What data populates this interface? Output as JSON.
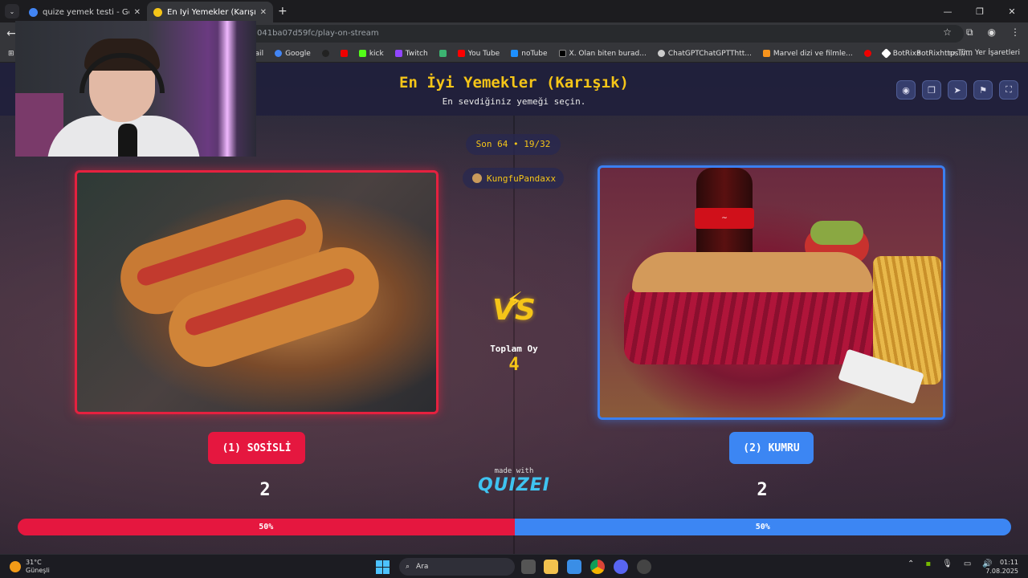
{
  "browser": {
    "tabs": [
      {
        "title": "quize yemek testi - Google'da A",
        "active": false
      },
      {
        "title": "En İyi Yemekler (Karışık) - Quize",
        "active": true
      }
    ],
    "new_tab_glyph": "+",
    "address": "041ba07d59fc/play-on-stream",
    "bookmarks": [
      "ail",
      "Google",
      "kick",
      "Twitch",
      "You Tube",
      "noTube",
      "X. Olan biten burad...",
      "ChatGPTChatGPTThtt...",
      "Marvel dizi ve filmle...",
      "BotRixBotRixhttps://..."
    ],
    "all_bookmarks": "Tüm Yer İşaretleri"
  },
  "quiz": {
    "title": "En İyi Yemekler (Karışık)",
    "subtitle": "En sevdiğiniz yemeği seçin.",
    "round": "Son 64 • 19/32",
    "streamer": "KungfuPandaxx",
    "vs_label": "VS",
    "total_label": "Toplam Oy",
    "total_votes": "4",
    "made_with": "made with",
    "brand": "QUIZEI",
    "options": [
      {
        "label": "(1) SOSİSLİ",
        "votes": "2",
        "percent": "50%",
        "share": 0.5,
        "color": "#e5173f"
      },
      {
        "label": "(2) KUMRU",
        "votes": "2",
        "percent": "50%",
        "share": 0.5,
        "color": "#3c86f3"
      }
    ],
    "header_icons": [
      "eye-icon",
      "copy-icon",
      "send-icon",
      "flag-icon",
      "fullscreen-icon"
    ]
  },
  "webcam": {
    "description_icon": "webcam-overlay"
  },
  "taskbar": {
    "temp": "31°C",
    "weather": "Güneşli",
    "search_placeholder": "Ara",
    "time": "01:11",
    "date": "7.08.2025"
  }
}
